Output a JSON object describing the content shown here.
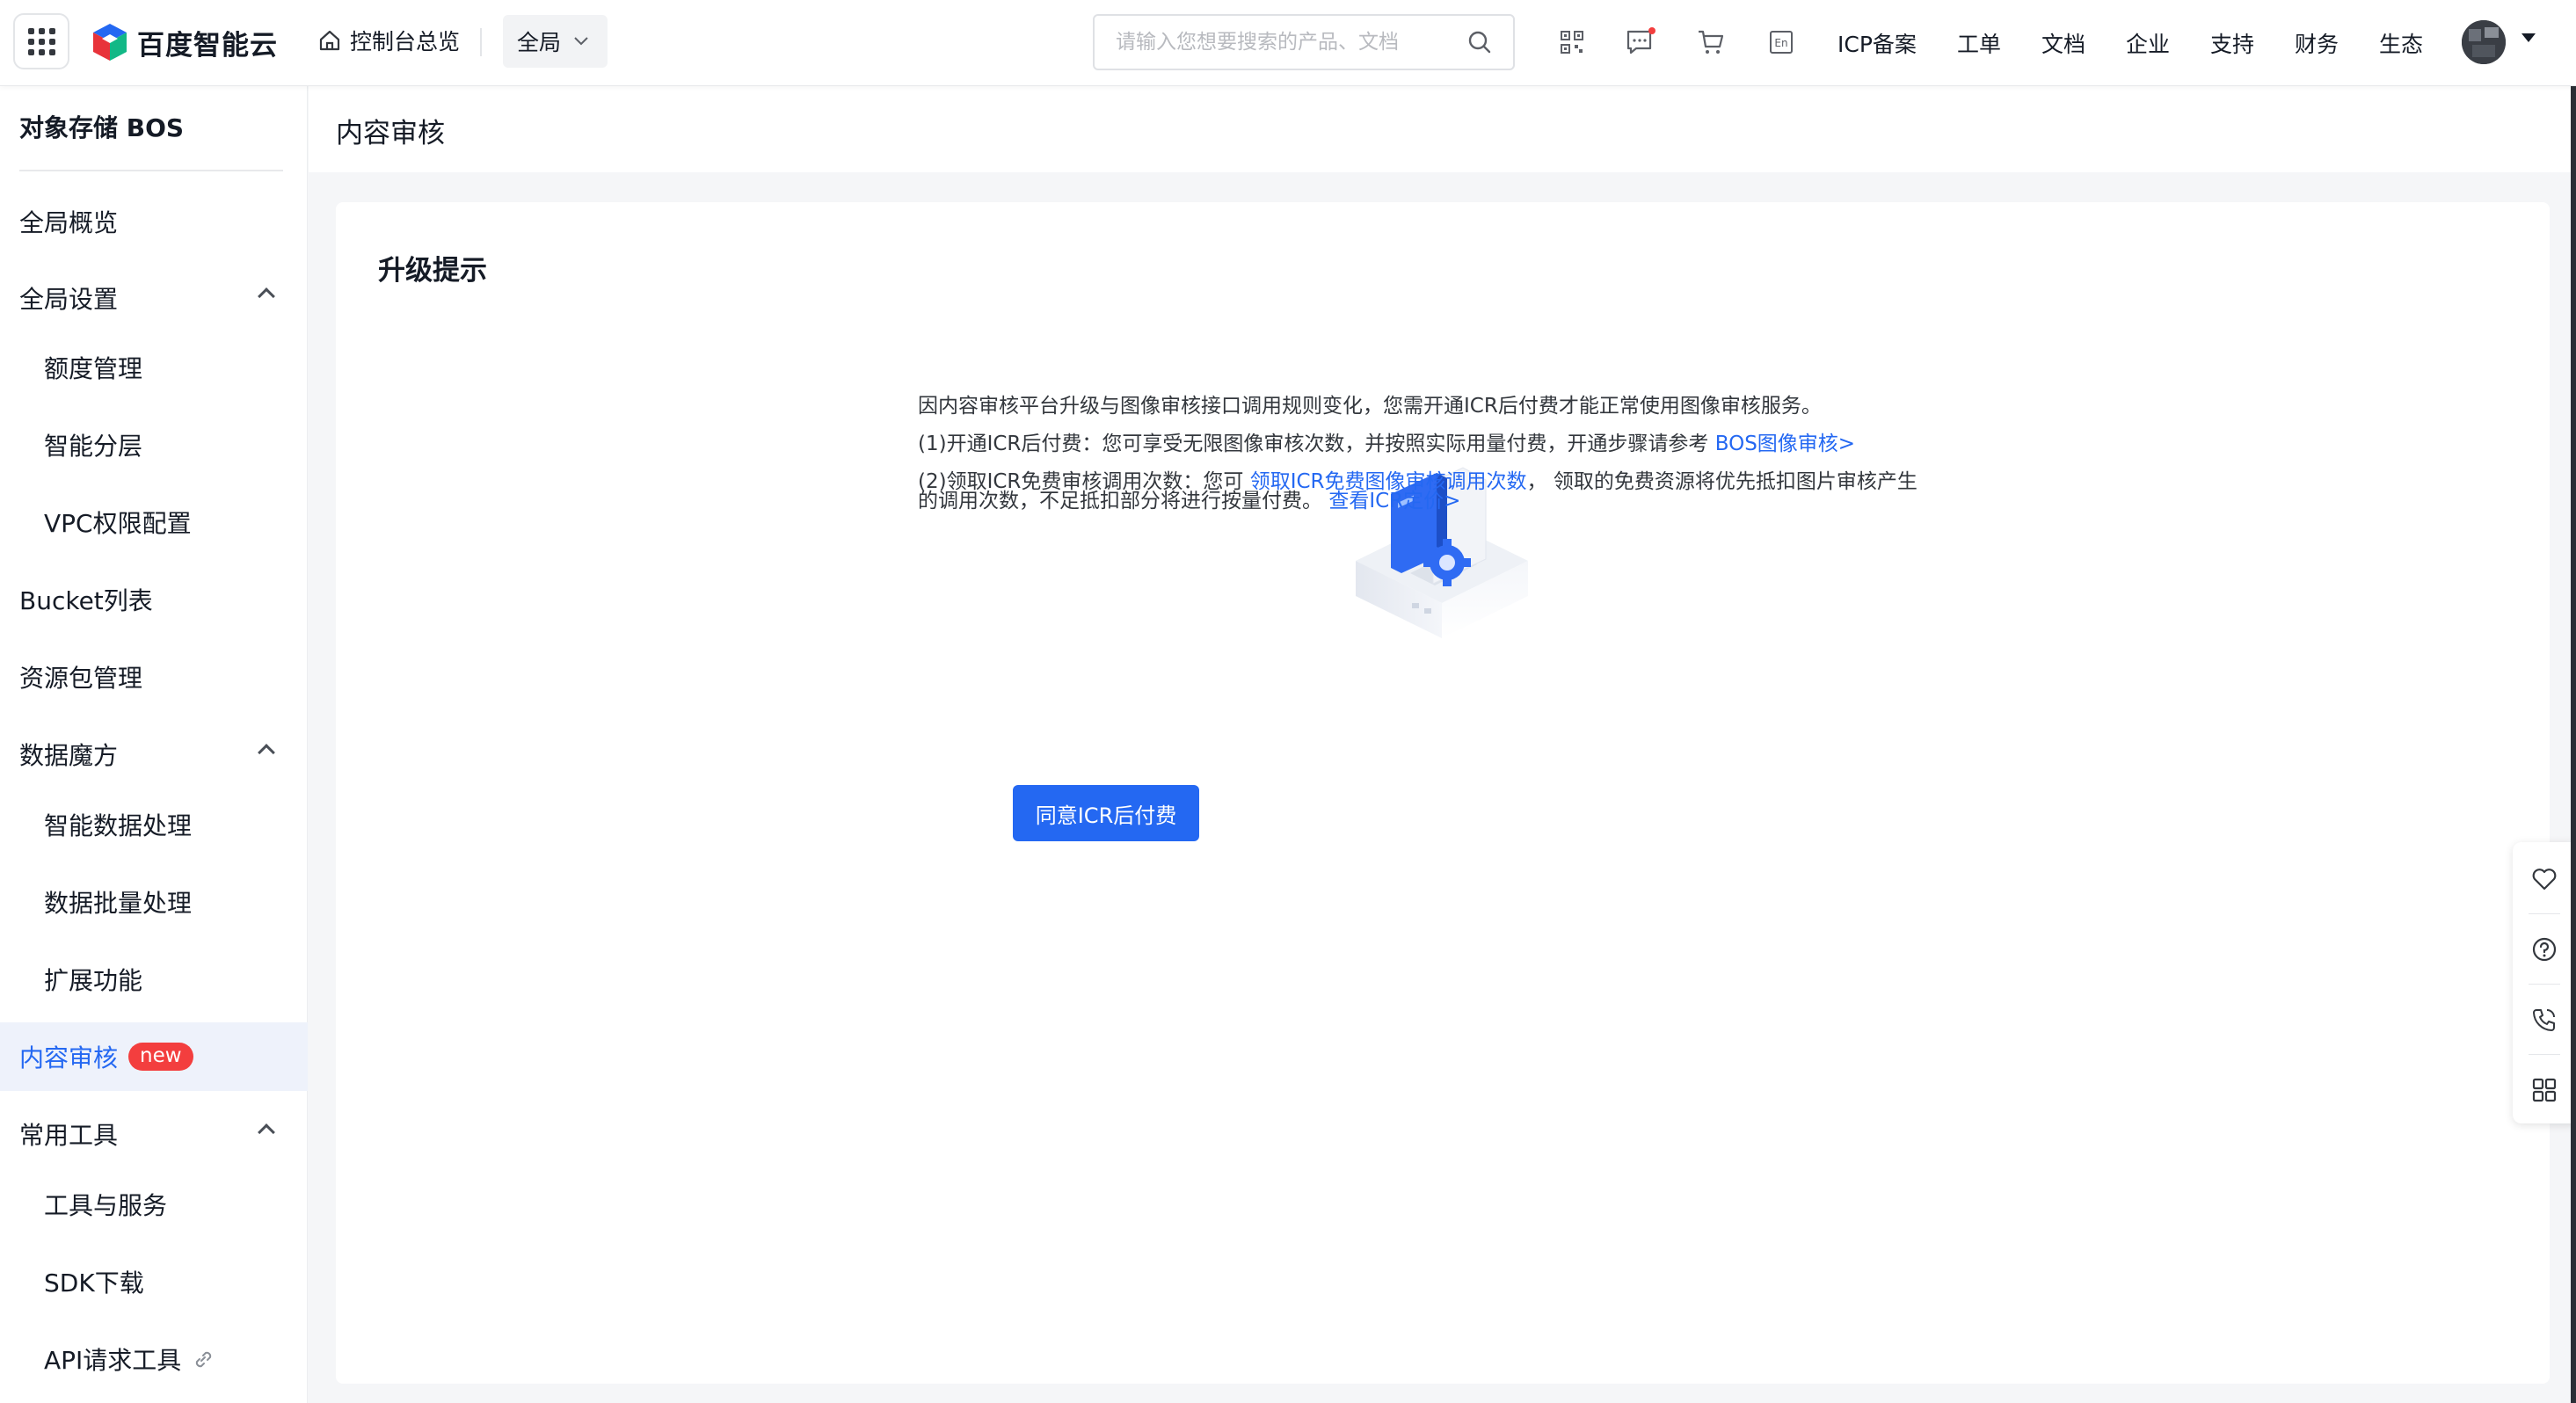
{
  "brand": {
    "name": "百度智能云",
    "accent": "#2468f2",
    "badge_color": "#f33e3e"
  },
  "topbar": {
    "console_home": "控制台总览",
    "region": "全局",
    "search_placeholder": "请输入您想要搜索的产品、文档",
    "icons": [
      "qrcode-icon",
      "message-icon",
      "cart-icon",
      "language-en-icon"
    ],
    "language_label": "En",
    "links": [
      "ICP备案",
      "工单",
      "文档",
      "企业",
      "支持",
      "财务",
      "生态"
    ]
  },
  "sidebar": {
    "title": "对象存储 BOS",
    "items": [
      {
        "label": "全局概览",
        "level": 1
      },
      {
        "label": "全局设置",
        "level": 1,
        "expanded": true
      },
      {
        "label": "额度管理",
        "level": 2
      },
      {
        "label": "智能分层",
        "level": 2
      },
      {
        "label": "VPC权限配置",
        "level": 2
      },
      {
        "label": "Bucket列表",
        "level": 1
      },
      {
        "label": "资源包管理",
        "level": 1
      },
      {
        "label": "数据魔方",
        "level": 1,
        "expanded": true
      },
      {
        "label": "智能数据处理",
        "level": 2
      },
      {
        "label": "数据批量处理",
        "level": 2
      },
      {
        "label": "扩展功能",
        "level": 2
      },
      {
        "label": "内容审核",
        "level": 1,
        "active": true,
        "badge": "new"
      },
      {
        "label": "常用工具",
        "level": 1,
        "expanded": true
      },
      {
        "label": "工具与服务",
        "level": 2
      },
      {
        "label": "SDK下载",
        "level": 2
      },
      {
        "label": "API请求工具",
        "level": 2,
        "external_link": true
      }
    ]
  },
  "main": {
    "page_title": "内容审核",
    "card_title": "升级提示",
    "notice": {
      "line1": "因内容审核平台升级与图像审核接口调用规则变化，您需开通ICR后付费才能正常使用图像审核服务。",
      "item1_text": "(1)开通ICR后付费：您可享受无限图像审核次数，并按照实际用量付费，开通步骤请参考 ",
      "item1_link": "BOS图像审核>",
      "item2_text_a": "(2)领取ICR免费审核调用次数：您可 ",
      "item2_link": "领取ICR免费图像审核调用次数",
      "item2_text_b": "， 领取的免费资源将优先抵扣图片审核产生",
      "item2_text_c": "的调用次数，不足抵扣部分将进行按量付费。 ",
      "item2_link2": "查看ICR定价>"
    },
    "primary_button": "同意ICR后付费"
  },
  "float_tools": [
    "favorite-icon",
    "help-icon",
    "phone-icon",
    "apps-icon"
  ]
}
